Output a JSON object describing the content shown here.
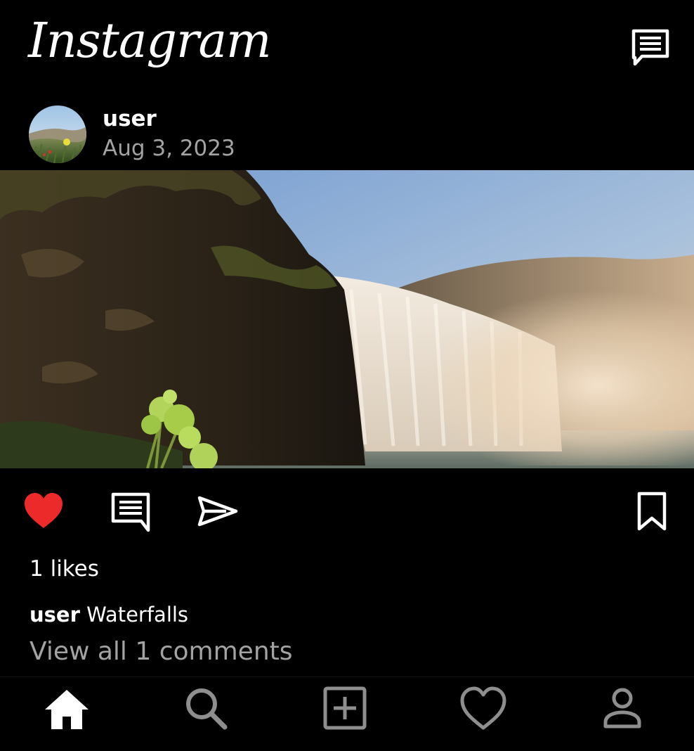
{
  "app": {
    "logo_text": "Instagram"
  },
  "header": {
    "messages_icon": "chat-bubble-icon"
  },
  "post": {
    "username": "user",
    "date": "Aug 3, 2023",
    "photo_subject": "waterfall",
    "liked": true,
    "likes_text": "1 likes",
    "caption_user": "user",
    "caption_text": "Waterfalls",
    "view_comments_text": "View all 1 comments"
  },
  "actions": {
    "like_icon": "heart-filled-icon",
    "comment_icon": "comment-icon",
    "share_icon": "send-icon",
    "save_icon": "bookmark-icon"
  },
  "bottom_nav": {
    "items": [
      {
        "name": "home",
        "icon": "home-icon",
        "active": true
      },
      {
        "name": "search",
        "icon": "search-icon",
        "active": false
      },
      {
        "name": "create",
        "icon": "add-post-icon",
        "active": false
      },
      {
        "name": "activity",
        "icon": "heart-outline-icon",
        "active": false
      },
      {
        "name": "profile",
        "icon": "profile-icon",
        "active": false
      }
    ]
  },
  "colors": {
    "background": "#000000",
    "text": "#ffffff",
    "muted_text": "#a3a3a3",
    "like_red": "#ed2a2a",
    "nav_active": "#ffffff",
    "nav_inactive": "#8e8e8e"
  }
}
